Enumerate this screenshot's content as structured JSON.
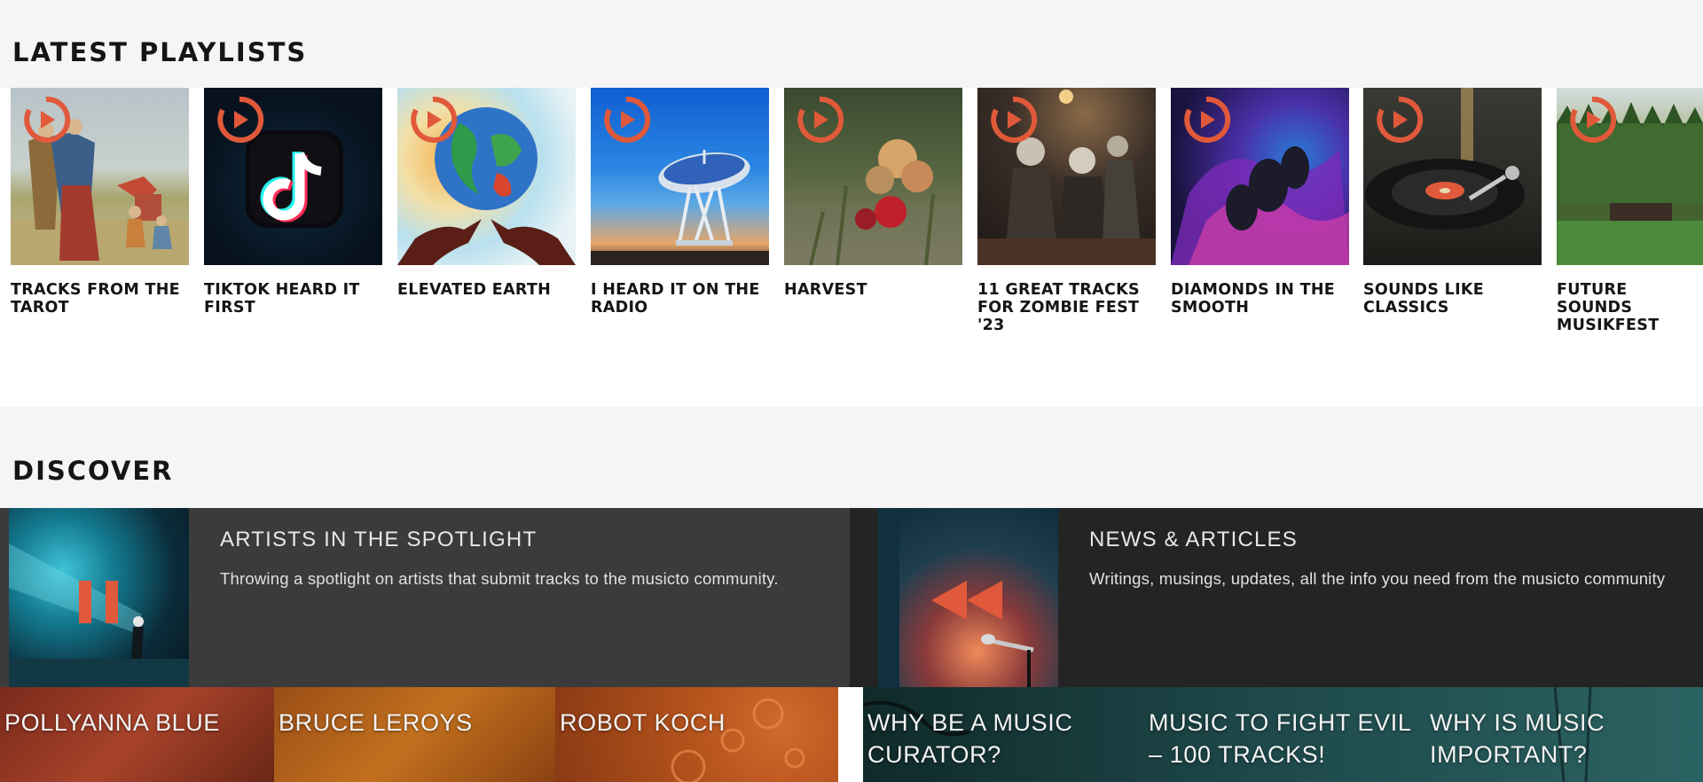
{
  "latest_playlists": {
    "heading": "LATEST PLAYLISTS",
    "items": [
      {
        "title": "TRACKS FROM THE TAROT",
        "icon": "play-icon"
      },
      {
        "title": "TIKTOK HEARD IT FIRST",
        "icon": "play-icon"
      },
      {
        "title": "ELEVATED EARTH",
        "icon": "play-icon"
      },
      {
        "title": "I HEARD IT ON THE RADIO",
        "icon": "play-icon"
      },
      {
        "title": "HARVEST",
        "icon": "play-icon"
      },
      {
        "title": "11 GREAT TRACKS FOR ZOMBIE FEST '23",
        "icon": "play-icon"
      },
      {
        "title": "DIAMONDS IN THE SMOOTH",
        "icon": "play-icon"
      },
      {
        "title": "SOUNDS LIKE CLASSICS",
        "icon": "play-icon"
      },
      {
        "title": "FUTURE SOUNDS MUSIKFEST",
        "icon": "play-icon"
      }
    ]
  },
  "discover": {
    "heading": "DISCOVER",
    "panels": [
      {
        "title": "ARTISTS IN THE SPOTLIGHT",
        "description": "Throwing a spotlight on artists that submit tracks to the musicto community.",
        "icon": "pause-icon"
      },
      {
        "title": "NEWS & ARTICLES",
        "description": "Writings, musings, updates, all the info you need from the musicto community",
        "icon": "rewind-icon"
      }
    ],
    "spotlight_tiles": [
      {
        "label": "POLLYANNA BLUE"
      },
      {
        "label": "BRUCE LEROYS"
      },
      {
        "label": "ROBOT KOCH"
      }
    ],
    "article_tiles": [
      {
        "label_line1": "WHY BE A MUSIC",
        "label_line2": "CURATOR?"
      },
      {
        "label_line1": "MUSIC TO FIGHT EVIL",
        "label_line2": "– 100 TRACKS!"
      },
      {
        "label_line1": "WHY IS MUSIC",
        "label_line2": "IMPORTANT?"
      }
    ]
  },
  "colors": {
    "accent": "#e0593a",
    "section_bg": "#f5f5f5",
    "panel_left_bg": "#3b3b3b",
    "panel_right_bg": "#242424"
  }
}
